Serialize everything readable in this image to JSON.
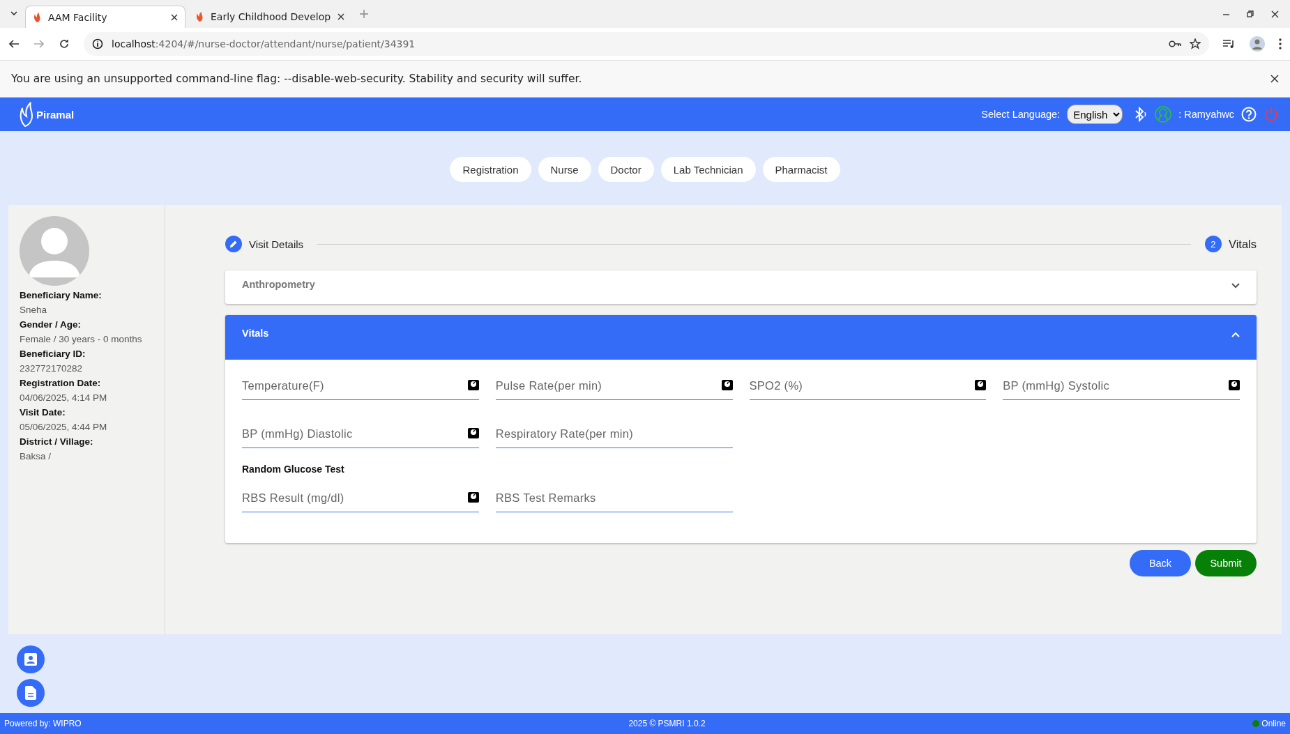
{
  "browser": {
    "tabs": [
      {
        "title": "AAM Facility",
        "selected": true
      },
      {
        "title": "Early Childhood Develop",
        "selected": false
      }
    ],
    "url": {
      "host": "localhost",
      "path": ":4204/#/nurse-doctor/attendant/nurse/patient/34391"
    },
    "infobar": "You are using an unsupported command-line flag: --disable-web-security. Stability and security will suffer."
  },
  "header": {
    "brand": "Piramal",
    "language_label": "Select Language:",
    "language": "English",
    "user": ": Ramyahwc"
  },
  "roles": [
    {
      "label": "Registration"
    },
    {
      "label": "Nurse"
    },
    {
      "label": "Doctor"
    },
    {
      "label": "Lab Technician"
    },
    {
      "label": "Pharmacist"
    }
  ],
  "patient": [
    {
      "label": "Beneficiary Name:",
      "value": "Sneha"
    },
    {
      "label": "Gender / Age:",
      "value": "Female / 30 years - 0 months"
    },
    {
      "label": "Beneficiary ID:",
      "value": "232772170282"
    },
    {
      "label": "Registration Date:",
      "value": "04/06/2025, 4:14 PM"
    },
    {
      "label": "Visit Date:",
      "value": "05/06/2025, 4:44 PM"
    },
    {
      "label": "District / Village:",
      "value": "Baksa /"
    }
  ],
  "stepper": [
    {
      "kind": "edit",
      "label": "Visit Details"
    },
    {
      "kind": "number",
      "number": "2",
      "label": "Vitals"
    }
  ],
  "sections": [
    {
      "title": "Anthropometry",
      "expanded": false
    },
    {
      "title": "Vitals",
      "expanded": true,
      "groups": [
        {
          "fields": [
            {
              "placeholder": "Temperature(F)",
              "device": true
            },
            {
              "placeholder": "Pulse Rate(per min)",
              "device": true
            },
            {
              "placeholder": "SPO2 (%)",
              "device": true
            },
            {
              "placeholder": "BP (mmHg) Systolic",
              "device": true
            },
            {
              "placeholder": "BP (mmHg) Diastolic",
              "device": true
            },
            {
              "placeholder": "Respiratory Rate(per min)",
              "device": false
            }
          ]
        },
        {
          "heading": "Random Glucose Test",
          "fields": [
            {
              "placeholder": "RBS Result (mg/dl)",
              "device": true
            },
            {
              "placeholder": "RBS Test Remarks",
              "device": false
            }
          ]
        }
      ]
    }
  ],
  "buttons": [
    {
      "kind": "primary",
      "label": "Back"
    },
    {
      "kind": "success",
      "label": "Submit"
    }
  ],
  "footer": {
    "left": "Powered by: WIPRO",
    "center": "2025 © PSMRI 1.0.2",
    "status": "Online",
    "online": true
  }
}
